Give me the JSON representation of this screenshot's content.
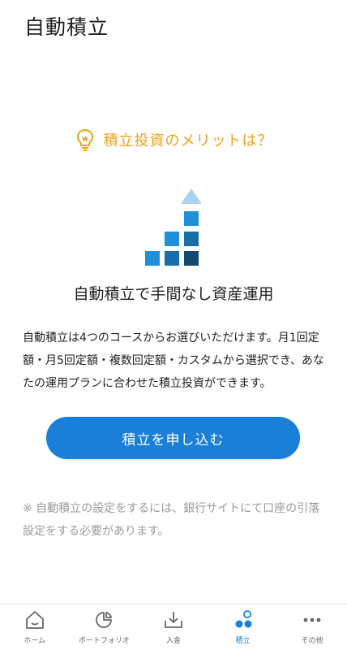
{
  "header": {
    "title": "自動積立"
  },
  "merit": {
    "label": "積立投資のメリットは？",
    "icon": "lightbulb-icon",
    "color": "#eda21a"
  },
  "hero": {
    "title": "自動積立で手間なし資産運用",
    "icon": "stair-blocks-illustration"
  },
  "description": "自動積立は4つのコースからお選びいただけます。月1回定額・月5回定額・複数回定額・カスタムから選択でき、あなたの運用プランに合わせた積立投資ができます。",
  "apply_button": {
    "label": "積立を申し込む",
    "color": "#1a7fd9"
  },
  "note": "※ 自動積立の設定をするには、銀行サイトにて口座の引落設定をする必要があります。",
  "bottom_nav": {
    "items": [
      {
        "label": "ホーム",
        "icon": "home-icon",
        "active": false
      },
      {
        "label": "ポートフォリオ",
        "icon": "portfolio-icon",
        "active": false
      },
      {
        "label": "入金",
        "icon": "deposit-icon",
        "active": false
      },
      {
        "label": "積立",
        "icon": "tsumitate-icon",
        "active": true
      },
      {
        "label": "その他",
        "icon": "more-icon",
        "active": false
      }
    ]
  }
}
